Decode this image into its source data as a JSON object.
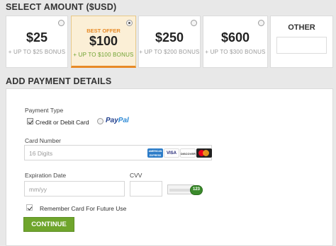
{
  "select_amount": {
    "title": "SELECT AMOUNT ($USD)",
    "options": [
      {
        "amount": "$25",
        "bonus": "+ UP TO $25 BONUS",
        "selected": false
      },
      {
        "amount": "$100",
        "bonus": "+ UP TO $100 BONUS",
        "tag": "BEST OFFER",
        "selected": true
      },
      {
        "amount": "$250",
        "bonus": "+ UP TO $200 BONUS",
        "selected": false
      },
      {
        "amount": "$600",
        "bonus": "+ UP TO $300 BONUS",
        "selected": false
      }
    ],
    "other_label": "OTHER",
    "other_value": ""
  },
  "payment": {
    "title": "ADD PAYMENT DETAILS",
    "type_label": "Payment Type",
    "card_option": "Credit or Debit Card",
    "paypal_a": "Pay",
    "paypal_b": "Pal",
    "card_number_label": "Card Number",
    "card_number_placeholder": "16 Digits",
    "card_logos": [
      "AMERICAN EXPRESS",
      "VISA",
      "DISCOVER",
      "MC"
    ],
    "expiry_label": "Expiration Date",
    "expiry_placeholder": "mm/yy",
    "cvv_label": "CVV",
    "cvv_hint": "123",
    "remember_label": "Remember Card For Future Use",
    "continue_label": "CONTINUE"
  }
}
